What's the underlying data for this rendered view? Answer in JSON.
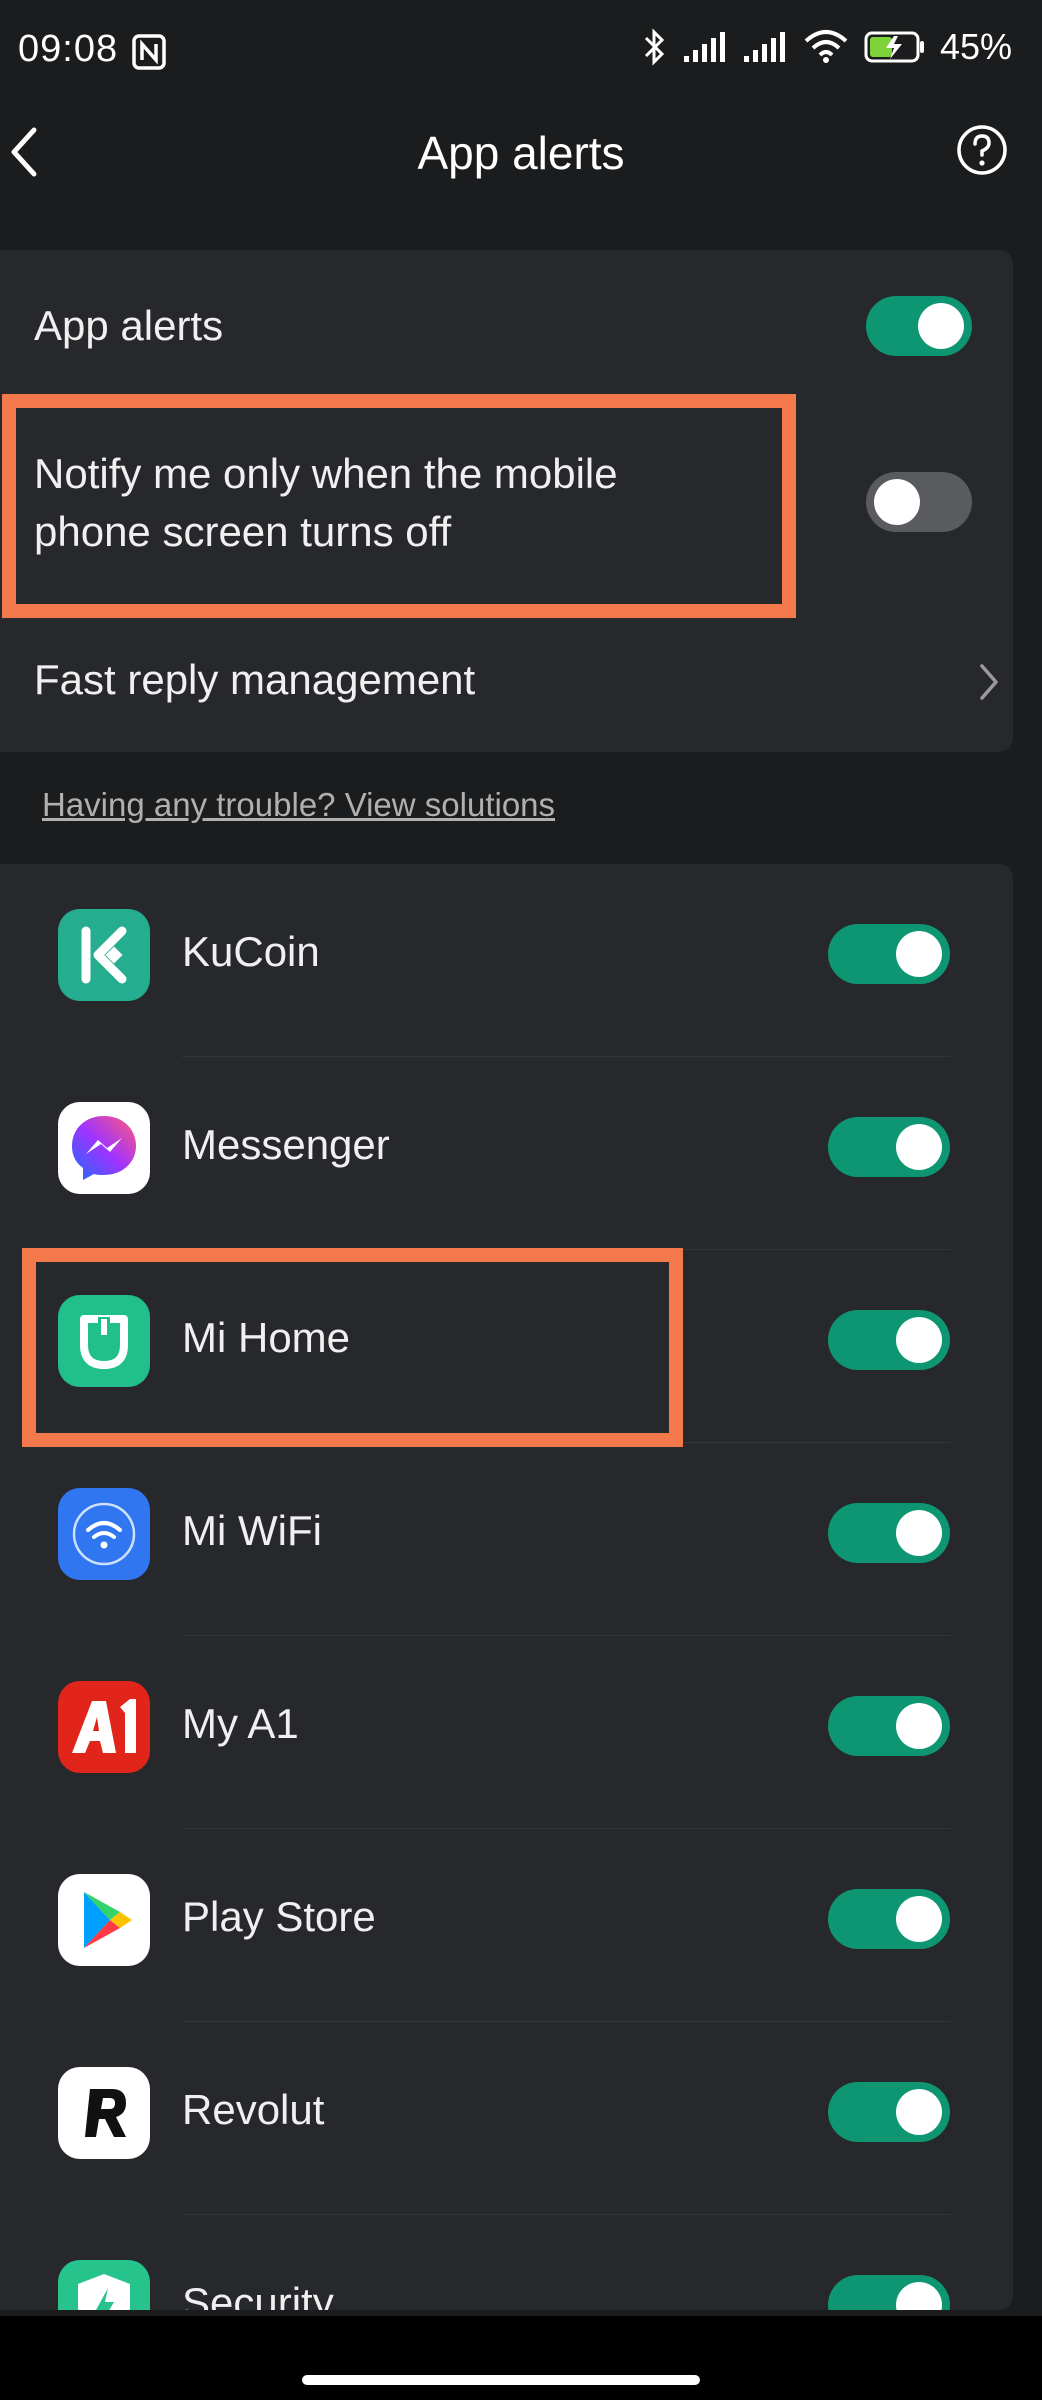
{
  "status_bar": {
    "time": "09:08",
    "battery_pct": "45%"
  },
  "header": {
    "title": "App alerts"
  },
  "settings": {
    "app_alerts_label": "App alerts",
    "app_alerts_on": true,
    "notify_label_line1": "Notify me only when the mobile",
    "notify_label_line2": "phone screen turns off",
    "notify_on": false,
    "fast_reply_label": "Fast reply management"
  },
  "trouble_link": "Having any trouble? View solutions",
  "apps": [
    {
      "name": "KuCoin",
      "icon": "kucoin-icon",
      "on": true
    },
    {
      "name": "Messenger",
      "icon": "messenger-icon",
      "on": true
    },
    {
      "name": "Mi Home",
      "icon": "mi-home-icon",
      "on": true
    },
    {
      "name": "Mi WiFi",
      "icon": "mi-wifi-icon",
      "on": true
    },
    {
      "name": "My A1",
      "icon": "my-a1-icon",
      "on": true
    },
    {
      "name": "Play Store",
      "icon": "play-store-icon",
      "on": true
    },
    {
      "name": "Revolut",
      "icon": "revolut-icon",
      "on": true
    },
    {
      "name": "Security",
      "icon": "security-icon",
      "on": true
    }
  ],
  "colors": {
    "accent_toggle": "#0e9672",
    "highlight": "#f4794a",
    "background": "#1b1c1e",
    "card": "#27282b"
  }
}
